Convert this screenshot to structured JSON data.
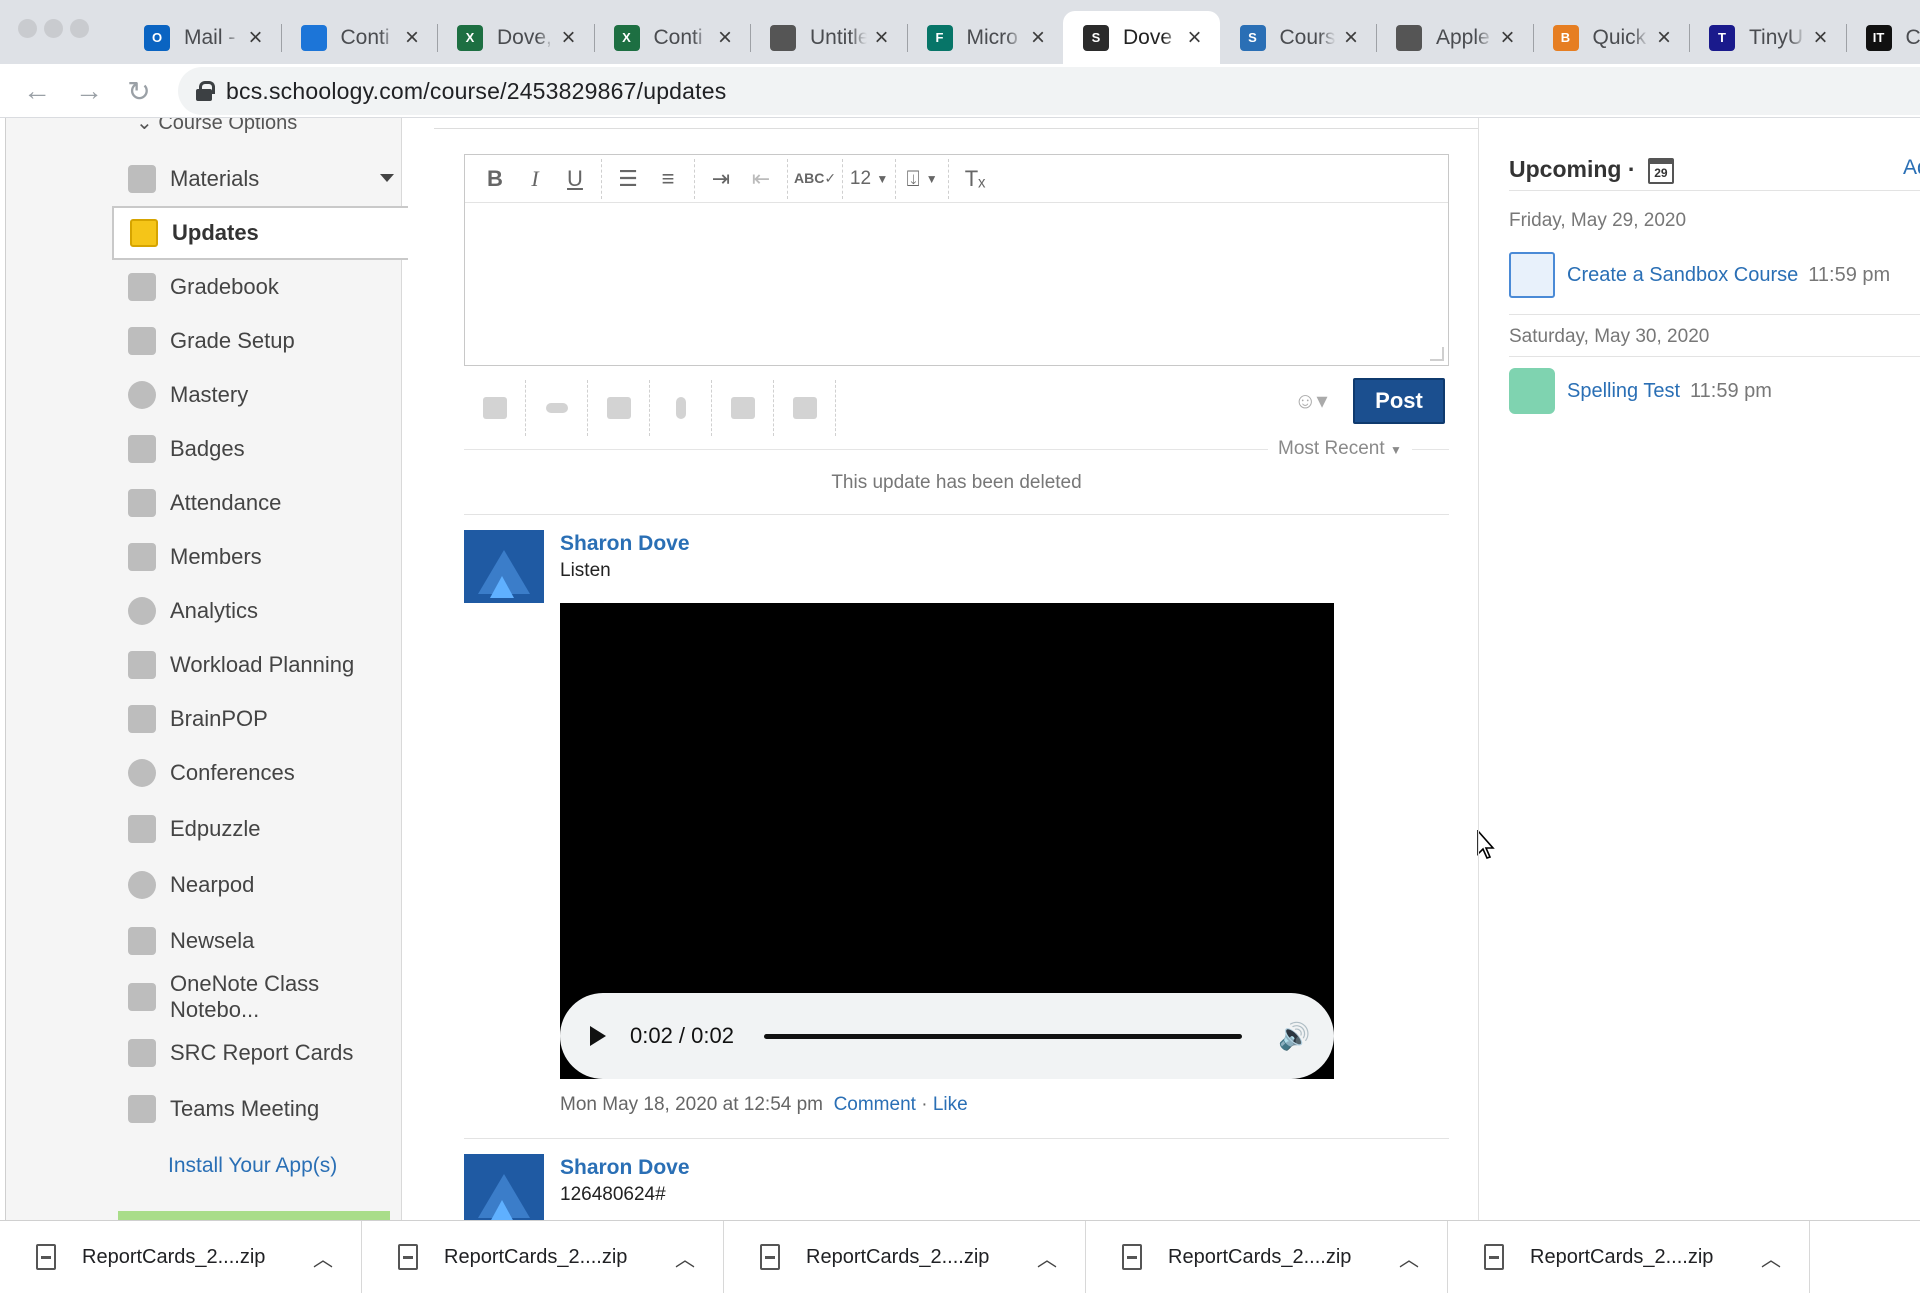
{
  "browser": {
    "tabs": [
      {
        "title": "Mail -",
        "icon": "outlook-icon",
        "color": "#0a64c2",
        "glyph": "O"
      },
      {
        "title": "Conti",
        "icon": "onedrive-icon",
        "color": "#1c75d8",
        "glyph": ""
      },
      {
        "title": "Dove,",
        "icon": "excel-icon",
        "color": "#1d6f42",
        "glyph": "X"
      },
      {
        "title": "Conti",
        "icon": "excel-icon",
        "color": "#1d6f42",
        "glyph": "X"
      },
      {
        "title": "Untitle",
        "icon": "apple-icon",
        "color": "#555555",
        "glyph": ""
      },
      {
        "title": "Micro",
        "icon": "forms-icon",
        "color": "#077568",
        "glyph": "F"
      },
      {
        "title": "Dove",
        "icon": "schoology-icon",
        "color": "#2b2b2b",
        "glyph": "S",
        "active": true
      },
      {
        "title": "Cours",
        "icon": "schoology-icon",
        "color": "#2a6fb5",
        "glyph": "S"
      },
      {
        "title": "Apple",
        "icon": "apple-icon",
        "color": "#555555",
        "glyph": ""
      },
      {
        "title": "Quick",
        "icon": "bitcoin-icon",
        "color": "#e67e22",
        "glyph": "B"
      },
      {
        "title": "TinyU",
        "icon": "tinyurl-icon",
        "color": "#1a1a8c",
        "glyph": "T"
      },
      {
        "title": "Ce",
        "icon": "it-icon",
        "color": "#111111",
        "glyph": "IT"
      }
    ],
    "url": "bcs.schoology.com/course/2453829867/updates"
  },
  "sidebar": {
    "course_options": "Course Options",
    "items": [
      {
        "label": "Materials",
        "icon": "materials-icon"
      },
      {
        "label": "Updates",
        "icon": "updates-icon"
      },
      {
        "label": "Gradebook",
        "icon": "gradebook-icon"
      },
      {
        "label": "Grade Setup",
        "icon": "grade-setup-icon"
      },
      {
        "label": "Mastery",
        "icon": "mastery-icon"
      },
      {
        "label": "Badges",
        "icon": "badges-icon"
      },
      {
        "label": "Attendance",
        "icon": "attendance-icon"
      },
      {
        "label": "Members",
        "icon": "members-icon"
      },
      {
        "label": "Analytics",
        "icon": "analytics-icon"
      },
      {
        "label": "Workload Planning",
        "icon": "workload-icon"
      },
      {
        "label": "BrainPOP",
        "icon": "brainpop-icon"
      },
      {
        "label": "Conferences",
        "icon": "conferences-icon"
      },
      {
        "label": "Edpuzzle",
        "icon": "edpuzzle-icon"
      },
      {
        "label": "Nearpod",
        "icon": "nearpod-icon"
      },
      {
        "label": "Newsela",
        "icon": "newsela-icon"
      },
      {
        "label": "OneNote Class Notebo...",
        "icon": "onenote-icon"
      },
      {
        "label": "SRC Report Cards",
        "icon": "report-cards-icon"
      },
      {
        "label": "Teams Meeting",
        "icon": "teams-icon"
      }
    ],
    "install_link": "Install Your App(s)"
  },
  "editor": {
    "font_size": "12",
    "post_label": "Post",
    "sort_label": "Most Recent"
  },
  "feed": {
    "deleted_message": "This update has been deleted",
    "posts": [
      {
        "author": "Sharon Dove",
        "text": "Listen",
        "audio_time": "0:02 / 0:02",
        "timestamp": "Mon May 18, 2020 at 12:54 pm",
        "comment_label": "Comment",
        "like_label": "Like"
      },
      {
        "author": "Sharon Dove",
        "text": "126480624#"
      }
    ]
  },
  "upcoming": {
    "title": "Upcoming",
    "separator": "·",
    "calendar_day": "29",
    "add_label": "Ad",
    "groups": [
      {
        "date": "Friday, May 29, 2020",
        "item": "Create a Sandbox Course",
        "time": "11:59 pm"
      },
      {
        "date": "Saturday, May 30, 2020",
        "item": "Spelling Test",
        "time": "11:59 pm"
      }
    ]
  },
  "downloads": [
    "ReportCards_2....zip",
    "ReportCards_2....zip",
    "ReportCards_2....zip",
    "ReportCards_2....zip",
    "ReportCards_2....zip"
  ],
  "colors": {
    "link": "#2a6fb5",
    "post_button": "#1b4f8f",
    "active_tab": "#ffffff"
  }
}
